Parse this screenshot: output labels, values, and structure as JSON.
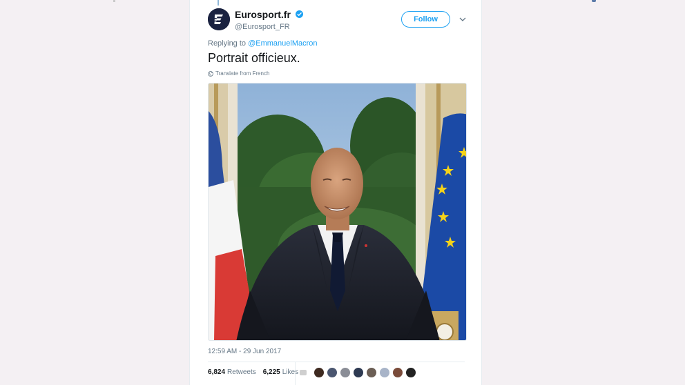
{
  "account": {
    "display_name": "Eurosport.fr",
    "handle": "@Eurosport_FR",
    "avatar_letter": "E"
  },
  "follow_label": "Follow",
  "reply": {
    "prefix": "Replying to ",
    "mention": "@EmmanuelMacron"
  },
  "tweet_text": "Portrait officieux.",
  "translate_label": "Translate from French",
  "timestamp": "12:59 AM - 29 Jun 2017",
  "stats": {
    "retweets_count": "6,824",
    "retweets_label": "Retweets",
    "likes_count": "6,225",
    "likes_label": "Likes"
  },
  "liker_avatar_colors": [
    "#cfcfcf",
    "#3e2a20",
    "#4a5670",
    "#8a8d96",
    "#2e3a52",
    "#6b5e55",
    "#a8b4c8",
    "#7a4b3a",
    "#222222"
  ],
  "colors": {
    "accent": "#1da1f2",
    "avatar_bg": "#1a2240",
    "verified": "#1da1f2"
  }
}
